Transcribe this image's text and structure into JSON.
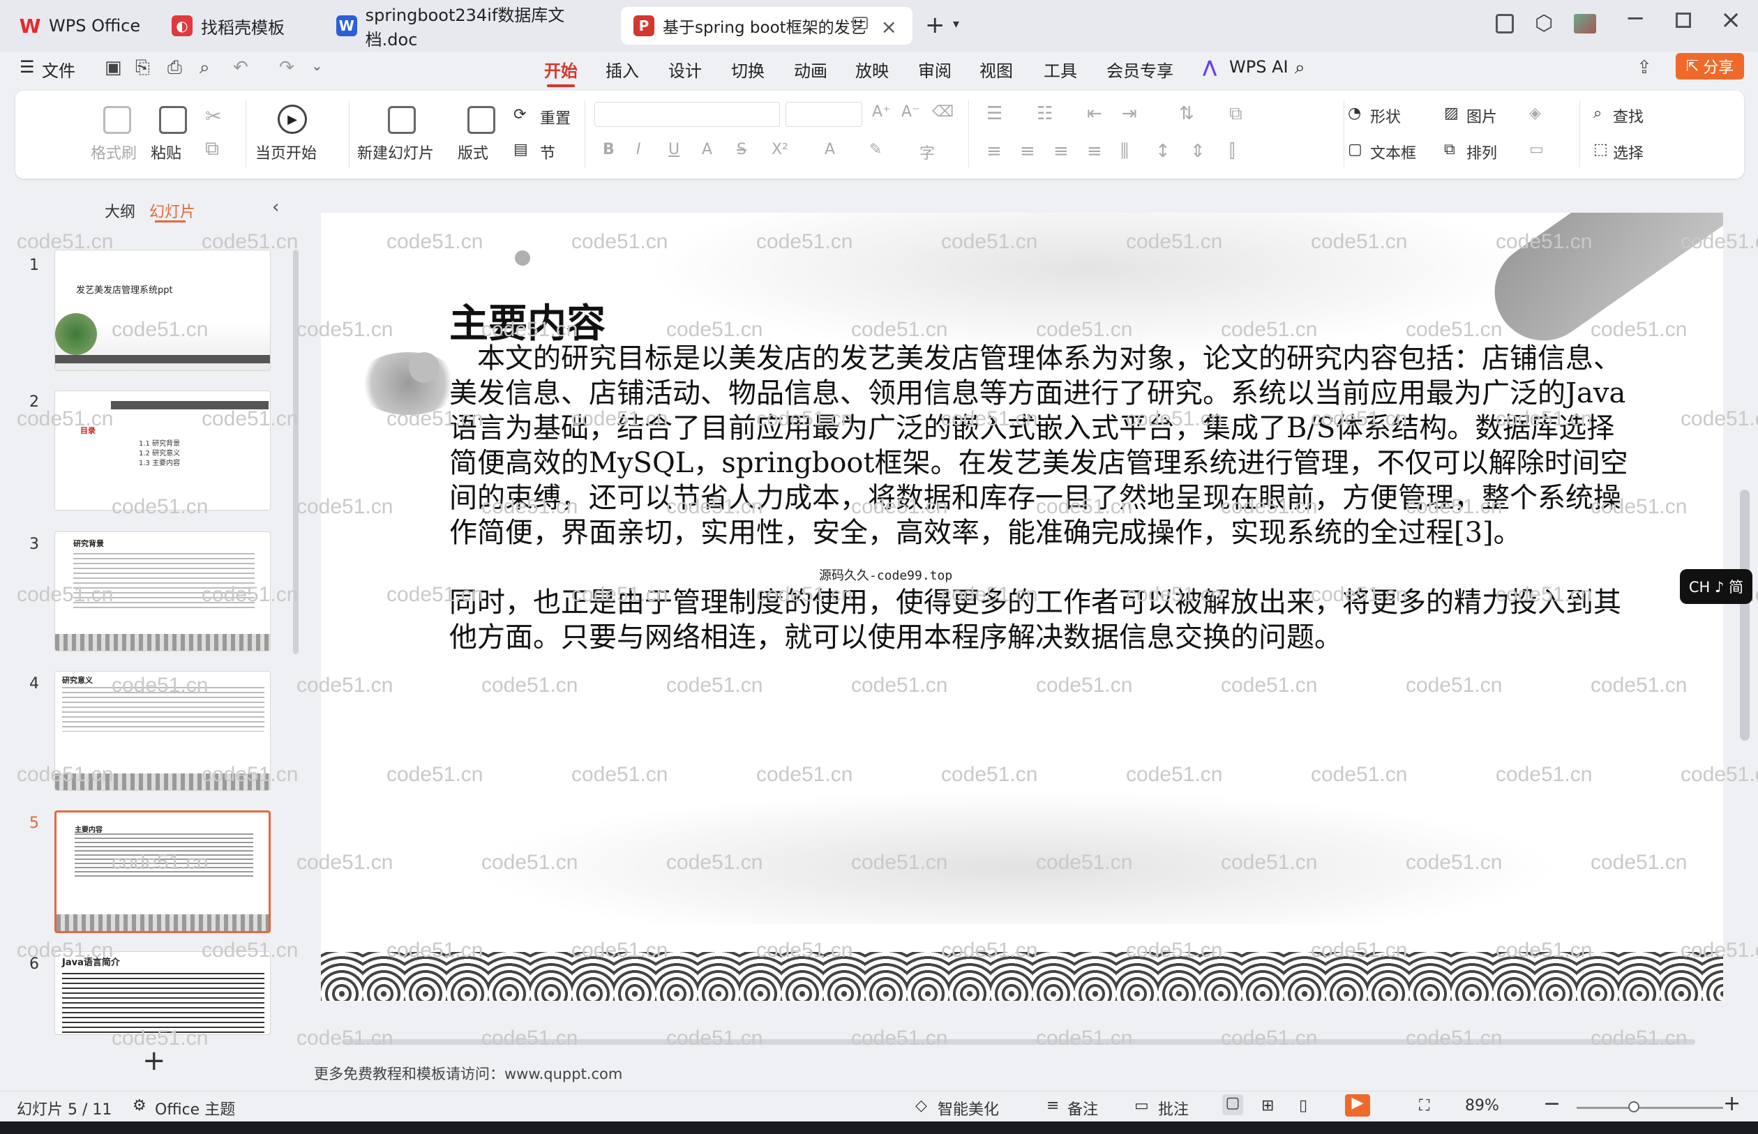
{
  "tabs": [
    {
      "label": "WPS Office",
      "icon": "wps-logo-icon",
      "color": "#e22b2b"
    },
    {
      "label": "找稻壳模板",
      "icon": "docer-icon",
      "color": "#e03a3e"
    },
    {
      "label": "springboot234if数据库文档.doc",
      "icon": "word-doc-icon",
      "color": "#2b5fd9"
    },
    {
      "label": "基于spring boot框架的发艺",
      "icon": "ppt-doc-icon",
      "color": "#d3372e"
    }
  ],
  "menu": {
    "file": "文件",
    "items": [
      "开始",
      "插入",
      "设计",
      "切换",
      "动画",
      "放映",
      "审阅",
      "视图",
      "工具",
      "会员专享"
    ],
    "active": "开始",
    "ai": "WPS AI",
    "share": "分享"
  },
  "ribbon": {
    "format_painter": "格式刷",
    "paste": "粘贴",
    "play_from_current": "当页开始",
    "new_slide": "新建幻灯片",
    "layout": "版式",
    "reset": "重置",
    "section": "节",
    "shape": "形状",
    "picture": "图片",
    "find": "查找",
    "textbox": "文本框",
    "arrange": "排列",
    "select": "选择"
  },
  "sidepane": {
    "outline_tab": "大纲",
    "slides_tab": "幻灯片",
    "thumbnails": [
      {
        "num": "1",
        "title": "发艺美发店管理系统ppt"
      },
      {
        "num": "2",
        "title": "目录",
        "items": [
          "1.1 研究背景",
          "1.2 研究意义",
          "1.3 主要内容"
        ]
      },
      {
        "num": "3",
        "title": "研究背景"
      },
      {
        "num": "4",
        "title": "研究意义"
      },
      {
        "num": "5",
        "title": "主要内容"
      },
      {
        "num": "6",
        "title": "Java语言简介"
      }
    ],
    "selected": "5"
  },
  "slide": {
    "title": "主要内容",
    "paragraph1": "本文的研究目标是以美发店的发艺美发店管理体系为对象，论文的研究内容包括：店铺信息、美发信息、店铺活动、物品信息、领用信息等方面进行了研究。系统以当前应用最为广泛的Java语言为基础，结合了目前应用最为广泛的嵌入式嵌入式平台，集成了B/S体系结构。数据库选择简便高效的MySQL，springboot框架。在发艺美发店管理系统进行管理，不仅可以解除时间空间的束缚，还可以节省人力成本，将数据和库存一目了然地呈现在眼前，方便管理，整个系统操作简便，界面亲切，实用性，安全，高效率，能准确完成操作，实现系统的全过程[3]。",
    "paragraph2": "同时，也正是由于管理制度的使用，使得更多的工作者可以被解放出来，将更多的精力投入到其他方面。只要与网络相连，就可以使用本程序解决数据信息交换的问题。",
    "source_mark": "源码久久-code99.top"
  },
  "notes": "更多免费教程和模板请访问：www.quppt.com",
  "ime_badge": "CH ♪ 简",
  "watermark": "code51.cn",
  "status": {
    "slide_counter": "幻灯片 5 / 11",
    "theme": "Office 主题",
    "beautify": "智能美化",
    "notes": "备注",
    "comments": "批注",
    "zoom": "89%"
  },
  "colors": {
    "accent": "#d3372e",
    "selected_thumb": "#e06a3c"
  }
}
